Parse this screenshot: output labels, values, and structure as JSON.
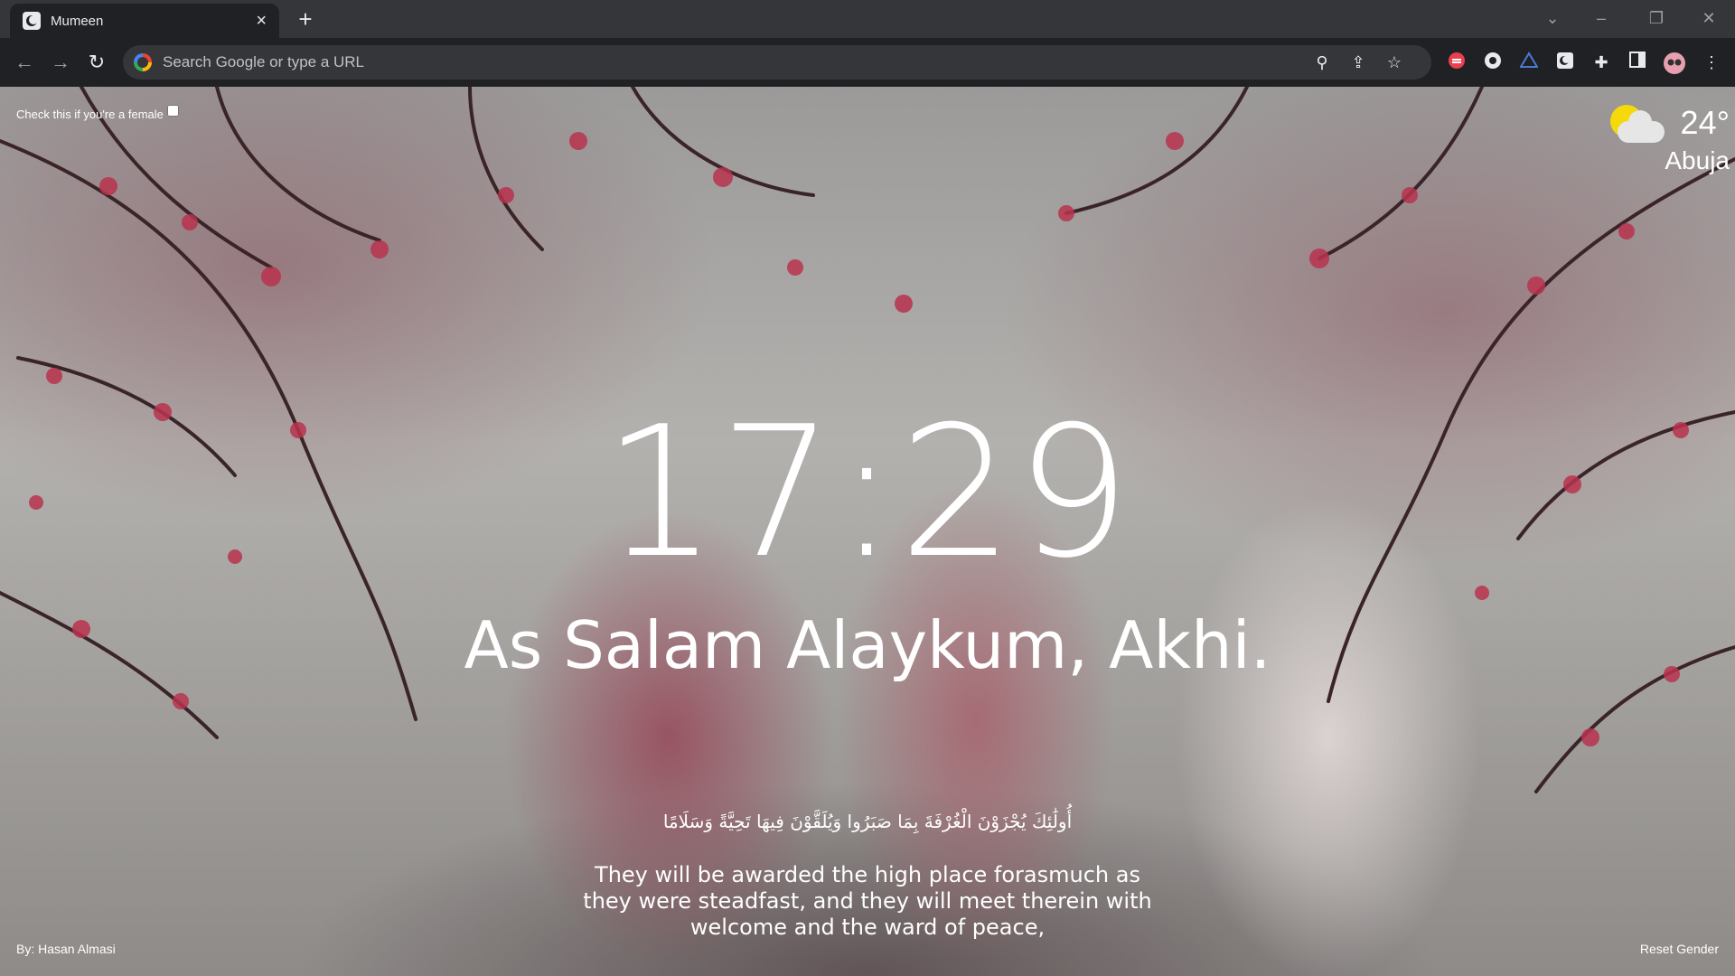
{
  "browser": {
    "tab": {
      "title": "Mumeen"
    },
    "omnibox": {
      "placeholder": "Search Google or type a URL"
    }
  },
  "page": {
    "gender_checkbox_label": "Check this if you're a female",
    "gender_checkbox_checked": false,
    "weather": {
      "temperature": "24°",
      "city": "Abuja",
      "icon": "partly-cloudy-icon"
    },
    "clock": "17:29",
    "greeting": "As Salam Alaykum, Akhi.",
    "verse": {
      "arabic": "أُولَٰئِكَ يُجْزَوْنَ الْغُرْفَةَ بِمَا صَبَرُوا وَيُلَقَّوْنَ فِيهَا تَحِيَّةً وَسَلَامًا",
      "translation": "They will be awarded the high place forasmuch as they were steadfast, and they will meet therein with welcome and the ward of peace,"
    },
    "credit": "By: Hasan Almasi",
    "reset_label": "Reset Gender"
  }
}
